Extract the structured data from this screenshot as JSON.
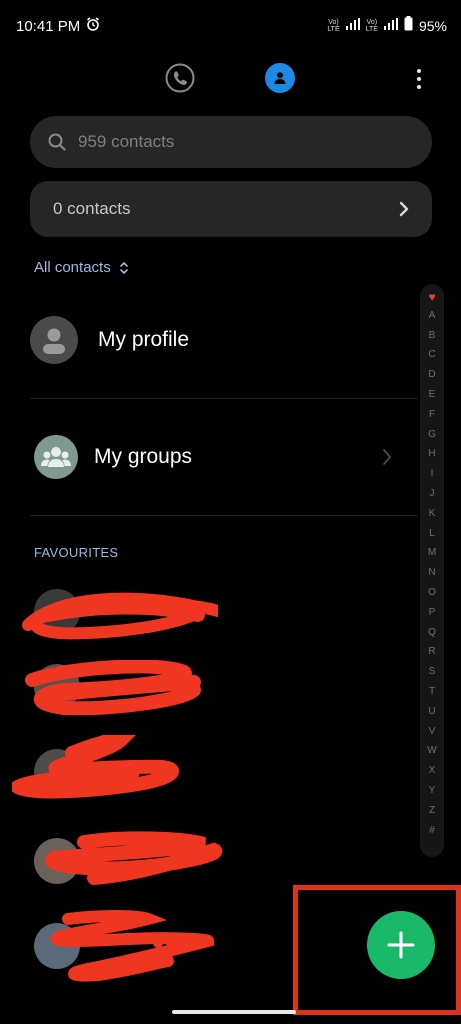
{
  "status_bar": {
    "time": "10:41 PM",
    "volte_1": "Vo)) LTE",
    "volte_2": "Vo)) LTE",
    "battery": "95%",
    "icons": [
      "alarm-icon",
      "signal-icon",
      "battery-icon"
    ]
  },
  "top_tabs": {
    "phone_icon": "phone-icon",
    "contacts_icon": "contacts-icon",
    "active_color": "#1e88e5"
  },
  "search": {
    "placeholder": "959 contacts"
  },
  "contacts_card": {
    "label": "0 contacts"
  },
  "filter": {
    "label": "All contacts"
  },
  "rows": {
    "my_profile": "My profile",
    "my_groups": "My groups"
  },
  "favourites": {
    "heading": "FAVOURITES",
    "note": "entries obscured by red scribbles",
    "count": 5
  },
  "alphabet_index": [
    "♥",
    "A",
    "B",
    "C",
    "D",
    "E",
    "F",
    "G",
    "H",
    "I",
    "J",
    "K",
    "L",
    "M",
    "N",
    "O",
    "P",
    "Q",
    "R",
    "S",
    "T",
    "U",
    "V",
    "W",
    "X",
    "Y",
    "Z",
    "#"
  ],
  "fab": {
    "icon": "plus-icon",
    "color": "#1ab96a",
    "highlight_color": "#e0301e"
  }
}
